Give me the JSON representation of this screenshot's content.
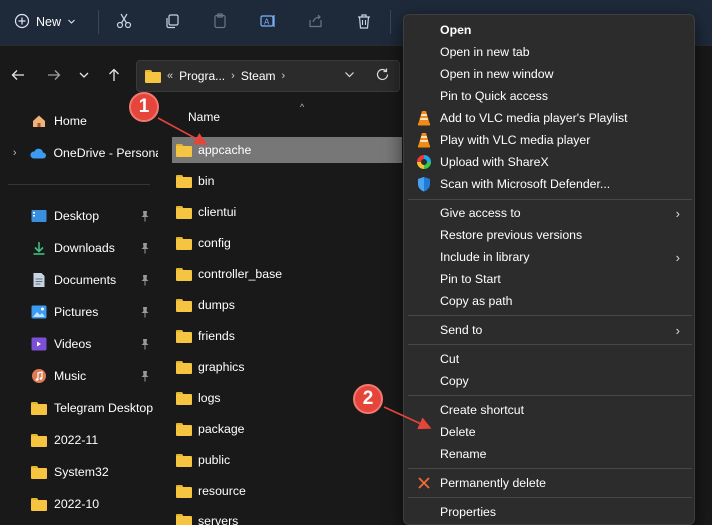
{
  "toolbar": {
    "new_label": "New",
    "icons": [
      "plus-circle-icon",
      "chevron-down-icon",
      "scissors-icon",
      "copy-icon",
      "paste-icon",
      "rename-icon",
      "share-icon",
      "trash-icon"
    ]
  },
  "address": {
    "overflow": "«",
    "crumbs": [
      "Progra...",
      "Steam"
    ]
  },
  "sidebar": {
    "home": "Home",
    "onedrive": "OneDrive - Persona",
    "pinned": [
      {
        "label": "Desktop"
      },
      {
        "label": "Downloads"
      },
      {
        "label": "Documents"
      },
      {
        "label": "Pictures"
      },
      {
        "label": "Videos"
      },
      {
        "label": "Music"
      }
    ],
    "folders": [
      {
        "label": "Telegram Desktop"
      },
      {
        "label": "2022-11"
      },
      {
        "label": "System32"
      },
      {
        "label": "2022-10"
      }
    ]
  },
  "filelist": {
    "header": "Name",
    "items": [
      "appcache",
      "bin",
      "clientui",
      "config",
      "controller_base",
      "dumps",
      "friends",
      "graphics",
      "logs",
      "package",
      "public",
      "resource",
      "servers"
    ],
    "selected": "appcache"
  },
  "context_menu": {
    "group1": [
      "Open",
      "Open in new tab",
      "Open in new window",
      "Pin to Quick access",
      "Add to VLC media player's Playlist",
      "Play with VLC media player",
      "Upload with ShareX",
      "Scan with Microsoft Defender..."
    ],
    "group2": [
      "Give access to",
      "Restore previous versions",
      "Include in library",
      "Pin to Start",
      "Copy as path"
    ],
    "group3": [
      "Send to"
    ],
    "group4": [
      "Cut",
      "Copy"
    ],
    "group5": [
      "Create shortcut",
      "Delete",
      "Rename"
    ],
    "group6": [
      "Permanently delete"
    ],
    "group7": [
      "Properties"
    ]
  },
  "annotations": {
    "badge1": "1",
    "badge2": "2"
  },
  "colors": {
    "accent_red": "#e5453b",
    "folder_yellow": "#f5c542",
    "selection": "#777777"
  }
}
